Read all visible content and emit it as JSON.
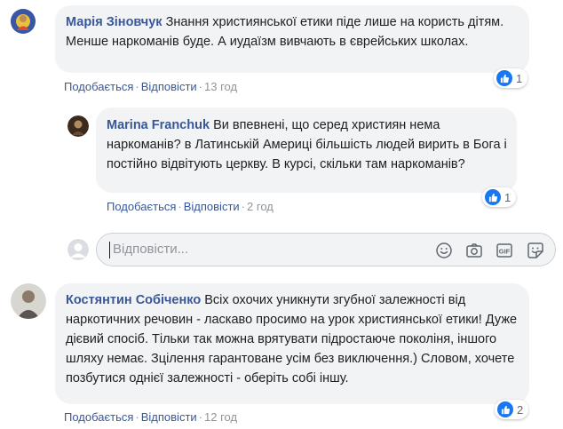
{
  "comments": [
    {
      "author": "Марія Зіновчук",
      "text": "Знання християнської етики піде лише на користь дітям. Менше наркоманів буде. А иудаїзм вивчають в єврейських школах.",
      "like_label": "Подобається",
      "reply_label": "Відповісти",
      "time": "13 год",
      "likes": "1"
    },
    {
      "author": "Marina Franchuk",
      "text": "Ви впевнені, що серед християн нема наркоманів? в Латинській Америці більшість людей вирить в Бога і постійно відвітують церкву. В курсі, скільки там наркоманів?",
      "like_label": "Подобається",
      "reply_label": "Відповісти",
      "time": "2 год",
      "likes": "1"
    },
    {
      "author": "Костянтин Собіченко",
      "text": "Всіх охочих уникнути згубної залежності від наркотичних речовин - ласкаво просимо на урок християнської етики! Дуже дієвий спосіб. Тільки так можна врятувати підростаюче поколіня, іншого шляху немає. Зцілення гарантоване усім без виключення.) Словом, хочете позбутися однієї залежності - оберіть собі іншу.",
      "like_label": "Подобається",
      "reply_label": "Відповісти",
      "time": "12 год",
      "likes": "2"
    }
  ],
  "reply_input": {
    "placeholder": "Відповісти..."
  },
  "separator": "·",
  "icons": {
    "emoji": "emoji-icon",
    "camera": "camera-icon",
    "gif": "gif-icon",
    "sticker": "sticker-icon",
    "like": "thumbs-up-icon"
  },
  "colors": {
    "author": "#385898",
    "bubble": "#f2f3f5",
    "like_badge": "#1877f2"
  }
}
